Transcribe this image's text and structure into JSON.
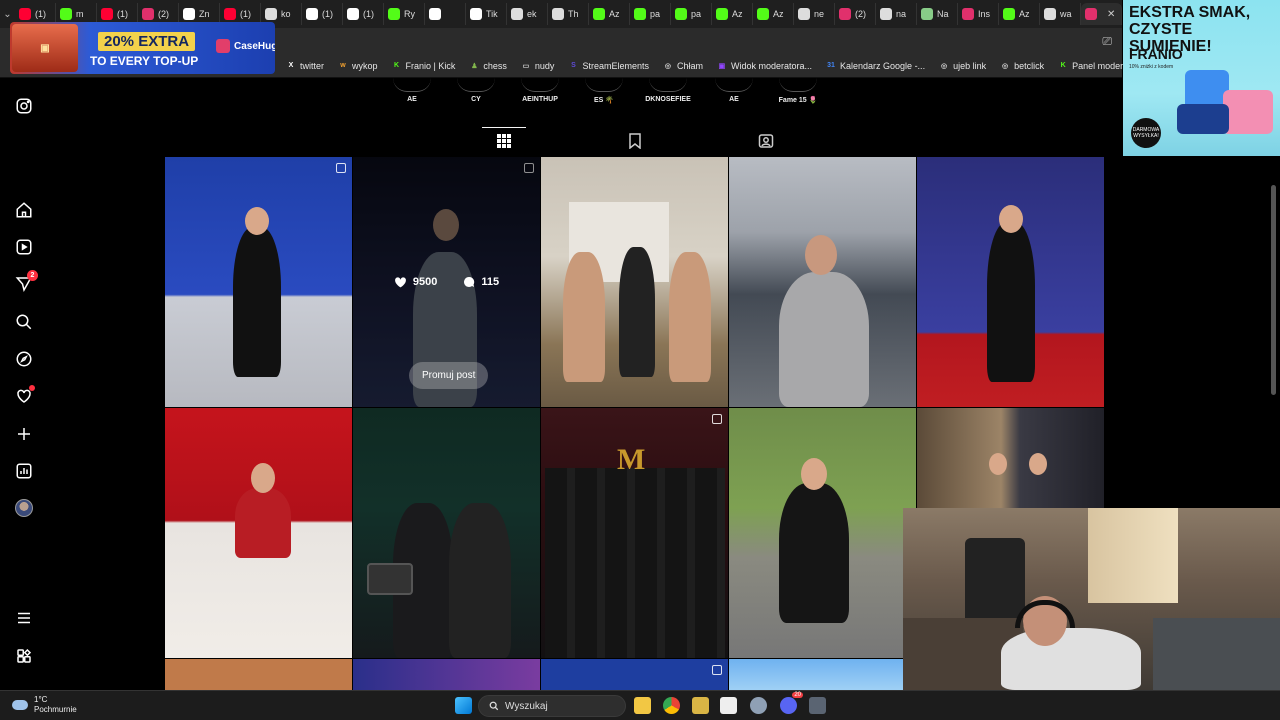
{
  "browser": {
    "tabs": [
      {
        "label": "(1)",
        "color": "#ff0033"
      },
      {
        "label": "m",
        "color": "#53fc18"
      },
      {
        "label": "(1)",
        "color": "#ff0033"
      },
      {
        "label": "(2)",
        "color": "#e1306c"
      },
      {
        "label": "Zn",
        "color": "#ffffff"
      },
      {
        "label": "(1)",
        "color": "#ff0033"
      },
      {
        "label": "ko",
        "color": "#dddddd"
      },
      {
        "label": "(1)",
        "color": "#ffffff"
      },
      {
        "label": "(1)",
        "color": "#ffffff"
      },
      {
        "label": "Ry",
        "color": "#53fc18"
      },
      {
        "label": "",
        "color": "#ffffff"
      },
      {
        "label": "Tik",
        "color": "#ffffff"
      },
      {
        "label": "ek",
        "color": "#dddddd"
      },
      {
        "label": "Th",
        "color": "#dddddd"
      },
      {
        "label": "Az",
        "color": "#53fc18"
      },
      {
        "label": "pa",
        "color": "#53fc18"
      },
      {
        "label": "pa",
        "color": "#53fc18"
      },
      {
        "label": "Az",
        "color": "#53fc18"
      },
      {
        "label": "Az",
        "color": "#53fc18"
      },
      {
        "label": "ne",
        "color": "#dddddd"
      },
      {
        "label": "(2)",
        "color": "#e1306c"
      },
      {
        "label": "na",
        "color": "#dddddd"
      },
      {
        "label": "Na",
        "color": "#88cc88"
      },
      {
        "label": "Ins",
        "color": "#e1306c"
      },
      {
        "label": "Az",
        "color": "#53fc18"
      },
      {
        "label": "wa",
        "color": "#dddddd"
      },
      {
        "label": "",
        "color": "#e1306c"
      }
    ],
    "bookmarks": [
      {
        "label": "twitter",
        "color": "#ffffff",
        "glyph": "X"
      },
      {
        "label": "wykop",
        "color": "#f0a030",
        "glyph": "w"
      },
      {
        "label": "Franio | Kick",
        "color": "#53fc18",
        "glyph": "K"
      },
      {
        "label": "chess",
        "color": "#81b64c",
        "glyph": "♟"
      },
      {
        "label": "nudy",
        "color": "#cccccc",
        "glyph": "▭"
      },
      {
        "label": "StreamElements",
        "color": "#5e4bd8",
        "glyph": "S"
      },
      {
        "label": "Chłam",
        "color": "#cccccc",
        "glyph": "◎"
      },
      {
        "label": "Widok moderatora...",
        "color": "#9146ff",
        "glyph": "▣"
      },
      {
        "label": "Kalendarz Google -...",
        "color": "#4285f4",
        "glyph": "31"
      },
      {
        "label": "ujeb link",
        "color": "#cccccc",
        "glyph": "◎"
      },
      {
        "label": "betclick",
        "color": "#cccccc",
        "glyph": "◎"
      },
      {
        "label": "Panel moderatora |...",
        "color": "#53fc18",
        "glyph": "K"
      }
    ]
  },
  "ad_top": {
    "percent": "20% EXTRA",
    "line2": "TO EVERY TOP-UP",
    "brand": "CaseHug"
  },
  "ad_right": {
    "headline": "EKSTRA SMAK, CZYSTE SUMIENIE!",
    "brand": "FRANIO",
    "small": "10% zniżki z kodem",
    "badge": "DARMOWA WYSYŁKA!"
  },
  "highlights": [
    "AE",
    "CY",
    "AEINTHUP",
    "ES 🌴",
    "DKNOSEFIEE",
    "AE",
    "Fame 15 🌷"
  ],
  "nav": {
    "messages_badge": "2"
  },
  "grid": {
    "hover_post": {
      "likes": "9500",
      "comments": "115",
      "promote_label": "Promuj post"
    }
  },
  "taskbar": {
    "temp": "1°C",
    "weather": "Pochmurnie",
    "search_placeholder": "Wyszukaj",
    "notif_badge": "20"
  }
}
